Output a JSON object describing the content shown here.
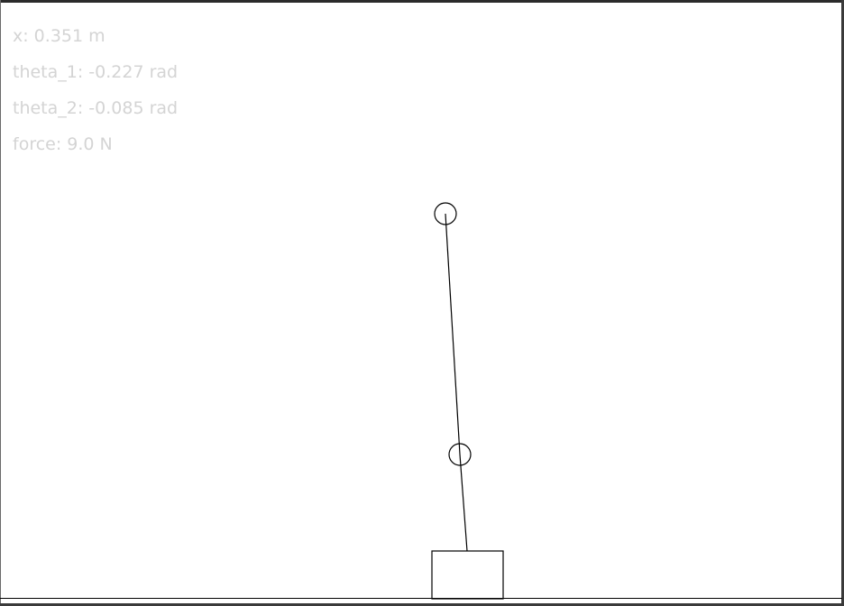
{
  "hud": {
    "x_text": "x: 0.351 m",
    "theta1_text": "theta_1: -0.227 rad",
    "theta2_text": "theta_2: -0.085 rad",
    "force_text": "force: 9.0 N"
  },
  "state": {
    "x_m": 0.351,
    "theta_1_rad": -0.227,
    "theta_2_rad": -0.085,
    "force_N": 9.0
  },
  "colors": {
    "background": "#ffffff",
    "hud_text": "#d4d4d4",
    "stroke": "#000000",
    "frame_border": "#2b2b2b"
  }
}
